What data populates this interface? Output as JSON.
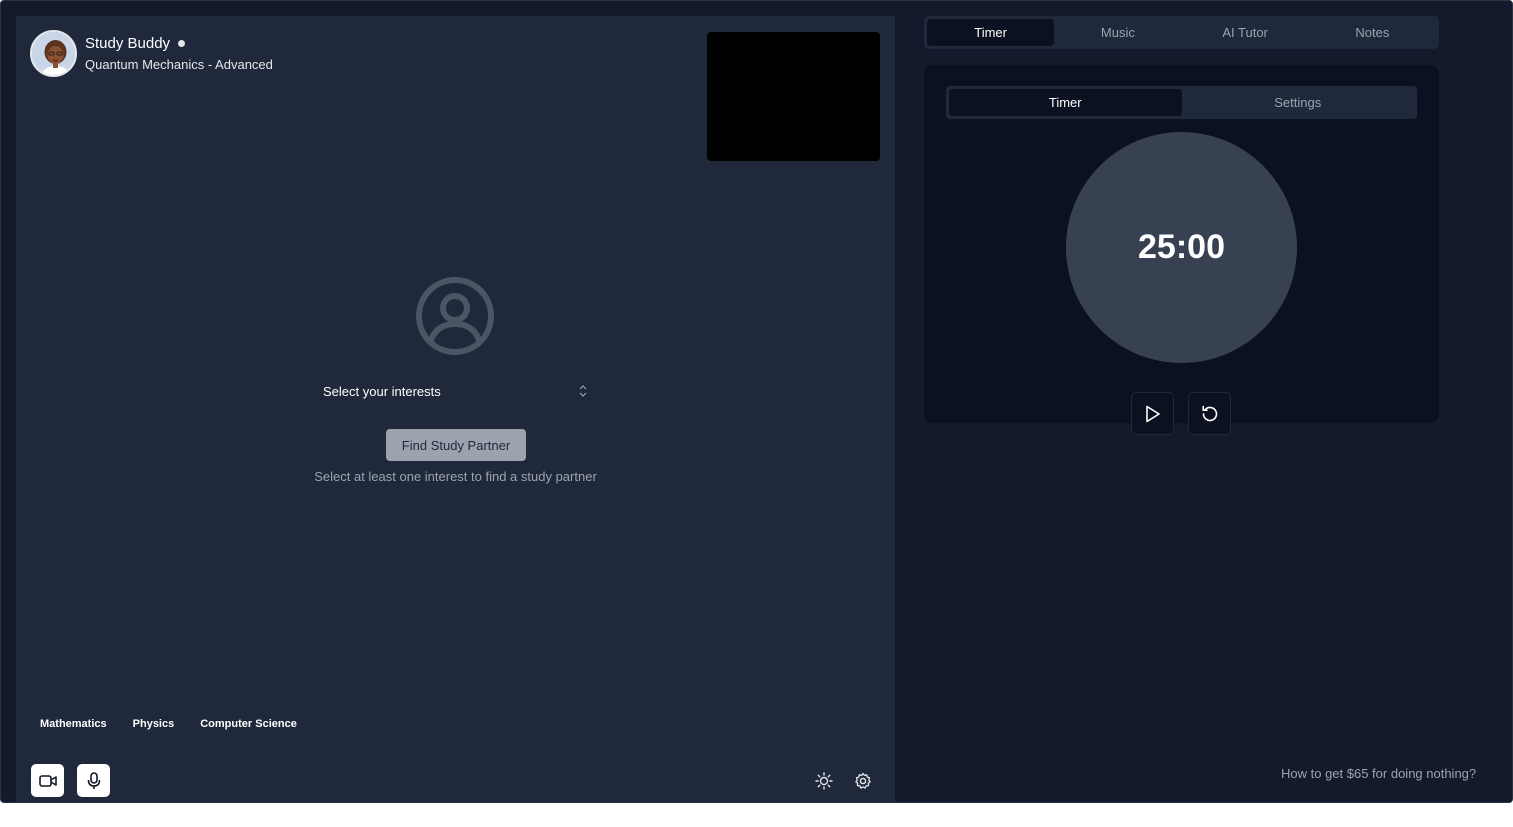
{
  "profile": {
    "name": "Study Buddy",
    "topic": "Quantum Mechanics - Advanced"
  },
  "match": {
    "select_label": "Select your interests",
    "find_button": "Find Study Partner",
    "hint": "Select at least one interest to find a study partner"
  },
  "tags": [
    "Mathematics",
    "Physics",
    "Computer Science"
  ],
  "controls": {
    "icons": [
      "video-icon",
      "microphone-icon",
      "sun-icon",
      "gear-icon"
    ]
  },
  "right_tabs": [
    "Timer",
    "Music",
    "AI Tutor",
    "Notes"
  ],
  "right_active": "Timer",
  "timer": {
    "sub_tabs": [
      "Timer",
      "Settings"
    ],
    "value": "25:00",
    "icons": [
      "play-icon",
      "reset-icon"
    ]
  },
  "promo": "How to get $65 for doing nothing?",
  "colors": {
    "app_bg": "#121a2c",
    "panel_bg": "#1f293b",
    "card_bg": "#0b1120",
    "dial_bg": "#374151",
    "muted": "#9ca3af"
  }
}
